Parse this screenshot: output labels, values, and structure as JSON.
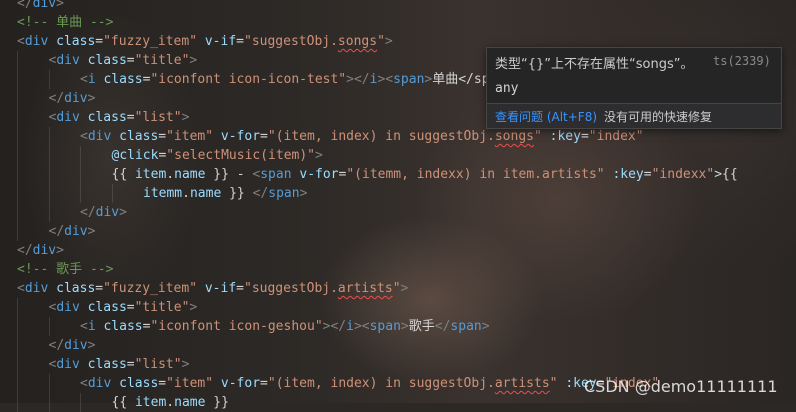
{
  "editor": {
    "lines": [
      [
        {
          "t": "</",
          "c": "punc"
        },
        {
          "t": "div",
          "c": "tag"
        },
        {
          "t": ">",
          "c": "punc"
        }
      ],
      [
        {
          "t": "<!-- 单曲 -->",
          "c": "comment"
        }
      ],
      [
        {
          "t": "<",
          "c": "punc"
        },
        {
          "t": "div",
          "c": "tag"
        },
        {
          "t": " "
        },
        {
          "t": "class",
          "c": "attr"
        },
        {
          "t": "=",
          "c": "text"
        },
        {
          "t": "\"fuzzy_item\"",
          "c": "str"
        },
        {
          "t": " "
        },
        {
          "t": "v-if",
          "c": "attr"
        },
        {
          "t": "=",
          "c": "text"
        },
        {
          "t": "\"suggestObj.",
          "c": "str"
        },
        {
          "t": "songs",
          "c": "str",
          "squiggle": true
        },
        {
          "t": "\"",
          "c": "str"
        },
        {
          "t": ">",
          "c": "punc"
        }
      ],
      [
        {
          "t": "<",
          "c": "punc"
        },
        {
          "t": "div",
          "c": "tag"
        },
        {
          "t": " "
        },
        {
          "t": "class",
          "c": "attr"
        },
        {
          "t": "=",
          "c": "text"
        },
        {
          "t": "\"title\"",
          "c": "str"
        },
        {
          "t": ">",
          "c": "punc"
        }
      ],
      [
        {
          "t": "<",
          "c": "punc"
        },
        {
          "t": "i",
          "c": "tag"
        },
        {
          "t": " "
        },
        {
          "t": "class",
          "c": "attr"
        },
        {
          "t": "=",
          "c": "text"
        },
        {
          "t": "\"iconfont icon-icon-test\"",
          "c": "str"
        },
        {
          "t": "></",
          "c": "punc"
        },
        {
          "t": "i",
          "c": "tag"
        },
        {
          "t": "><",
          "c": "punc"
        },
        {
          "t": "span",
          "c": "tag"
        },
        {
          "t": ">",
          "c": "punc"
        },
        {
          "t": "单曲</spa",
          "c": "text"
        }
      ],
      [
        {
          "t": "</",
          "c": "punc"
        },
        {
          "t": "div",
          "c": "tag"
        },
        {
          "t": ">",
          "c": "punc"
        }
      ],
      [
        {
          "t": "<",
          "c": "punc"
        },
        {
          "t": "div",
          "c": "tag"
        },
        {
          "t": " "
        },
        {
          "t": "class",
          "c": "attr"
        },
        {
          "t": "=",
          "c": "text"
        },
        {
          "t": "\"list\"",
          "c": "str"
        },
        {
          "t": ">",
          "c": "punc"
        }
      ],
      [
        {
          "t": "<",
          "c": "punc"
        },
        {
          "t": "div",
          "c": "tag"
        },
        {
          "t": " "
        },
        {
          "t": "class",
          "c": "attr"
        },
        {
          "t": "=",
          "c": "text"
        },
        {
          "t": "\"item\"",
          "c": "str"
        },
        {
          "t": " "
        },
        {
          "t": "v-for",
          "c": "attr"
        },
        {
          "t": "=",
          "c": "text"
        },
        {
          "t": "\"(item, index) in suggestObj.",
          "c": "str"
        },
        {
          "t": "songs",
          "c": "str",
          "squiggle": true
        },
        {
          "t": "\"",
          "c": "str"
        },
        {
          "t": " "
        },
        {
          "t": ":key",
          "c": "attr"
        },
        {
          "t": "=",
          "c": "text"
        },
        {
          "t": "\"index\"",
          "c": "str"
        }
      ],
      [
        {
          "t": "@click",
          "c": "attr"
        },
        {
          "t": "=",
          "c": "text"
        },
        {
          "t": "\"selectMusic(item)\"",
          "c": "str"
        },
        {
          "t": ">",
          "c": "punc"
        }
      ],
      [
        {
          "t": "{{ ",
          "c": "text"
        },
        {
          "t": "item",
          "c": "expr"
        },
        {
          "t": ".",
          "c": "text"
        },
        {
          "t": "name",
          "c": "expr"
        },
        {
          "t": " }} - ",
          "c": "text"
        },
        {
          "t": "<",
          "c": "punc"
        },
        {
          "t": "span",
          "c": "tag"
        },
        {
          "t": " "
        },
        {
          "t": "v-for",
          "c": "attr"
        },
        {
          "t": "=",
          "c": "text"
        },
        {
          "t": "\"(itemm, indexx) in item.artists\"",
          "c": "str"
        },
        {
          "t": " "
        },
        {
          "t": ":key",
          "c": "attr"
        },
        {
          "t": "=",
          "c": "text"
        },
        {
          "t": "\"indexx\"",
          "c": "str"
        },
        {
          "t": ">{{",
          "c": "text"
        }
      ],
      [
        {
          "t": "itemm",
          "c": "expr"
        },
        {
          "t": ".",
          "c": "text"
        },
        {
          "t": "name",
          "c": "expr"
        },
        {
          "t": " }} ",
          "c": "text"
        },
        {
          "t": "</",
          "c": "punc"
        },
        {
          "t": "span",
          "c": "tag"
        },
        {
          "t": ">",
          "c": "punc"
        }
      ],
      [
        {
          "t": "</",
          "c": "punc"
        },
        {
          "t": "div",
          "c": "tag"
        },
        {
          "t": ">",
          "c": "punc"
        }
      ],
      [
        {
          "t": "</",
          "c": "punc"
        },
        {
          "t": "div",
          "c": "tag"
        },
        {
          "t": ">",
          "c": "punc"
        }
      ],
      [
        {
          "t": "</",
          "c": "punc"
        },
        {
          "t": "div",
          "c": "tag"
        },
        {
          "t": ">",
          "c": "punc"
        }
      ],
      [
        {
          "t": "<!-- 歌手 -->",
          "c": "comment"
        }
      ],
      [
        {
          "t": "<",
          "c": "punc"
        },
        {
          "t": "div",
          "c": "tag"
        },
        {
          "t": " "
        },
        {
          "t": "class",
          "c": "attr"
        },
        {
          "t": "=",
          "c": "text"
        },
        {
          "t": "\"fuzzy_item\"",
          "c": "str"
        },
        {
          "t": " "
        },
        {
          "t": "v-if",
          "c": "attr"
        },
        {
          "t": "=",
          "c": "text"
        },
        {
          "t": "\"suggestObj.",
          "c": "str"
        },
        {
          "t": "artists",
          "c": "str",
          "squiggle": true
        },
        {
          "t": "\"",
          "c": "str"
        },
        {
          "t": ">",
          "c": "punc"
        }
      ],
      [
        {
          "t": "<",
          "c": "punc"
        },
        {
          "t": "div",
          "c": "tag"
        },
        {
          "t": " "
        },
        {
          "t": "class",
          "c": "attr"
        },
        {
          "t": "=",
          "c": "text"
        },
        {
          "t": "\"title\"",
          "c": "str"
        },
        {
          "t": ">",
          "c": "punc"
        }
      ],
      [
        {
          "t": "<",
          "c": "punc"
        },
        {
          "t": "i",
          "c": "tag"
        },
        {
          "t": " "
        },
        {
          "t": "class",
          "c": "attr"
        },
        {
          "t": "=",
          "c": "text"
        },
        {
          "t": "\"iconfont icon-geshou\"",
          "c": "str"
        },
        {
          "t": "></",
          "c": "punc"
        },
        {
          "t": "i",
          "c": "tag"
        },
        {
          "t": "><",
          "c": "punc"
        },
        {
          "t": "span",
          "c": "tag"
        },
        {
          "t": ">",
          "c": "punc"
        },
        {
          "t": "歌手",
          "c": "text"
        },
        {
          "t": "</",
          "c": "punc"
        },
        {
          "t": "span",
          "c": "tag"
        },
        {
          "t": ">",
          "c": "punc"
        }
      ],
      [
        {
          "t": "</",
          "c": "punc"
        },
        {
          "t": "div",
          "c": "tag"
        },
        {
          "t": ">",
          "c": "punc"
        }
      ],
      [
        {
          "t": "<",
          "c": "punc"
        },
        {
          "t": "div",
          "c": "tag"
        },
        {
          "t": " "
        },
        {
          "t": "class",
          "c": "attr"
        },
        {
          "t": "=",
          "c": "text"
        },
        {
          "t": "\"list\"",
          "c": "str"
        },
        {
          "t": ">",
          "c": "punc"
        }
      ],
      [
        {
          "t": "<",
          "c": "punc"
        },
        {
          "t": "div",
          "c": "tag"
        },
        {
          "t": " "
        },
        {
          "t": "class",
          "c": "attr"
        },
        {
          "t": "=",
          "c": "text"
        },
        {
          "t": "\"item\"",
          "c": "str"
        },
        {
          "t": " "
        },
        {
          "t": "v-for",
          "c": "attr"
        },
        {
          "t": "=",
          "c": "text"
        },
        {
          "t": "\"(item, index) in suggestObj.",
          "c": "str"
        },
        {
          "t": "artists",
          "c": "str",
          "squiggle": true
        },
        {
          "t": "\"",
          "c": "str"
        },
        {
          "t": " "
        },
        {
          "t": ":key",
          "c": "attr"
        },
        {
          "t": "=",
          "c": "text"
        },
        {
          "t": "\"index\"",
          "c": "str"
        }
      ],
      [
        {
          "t": "{{ ",
          "c": "text"
        },
        {
          "t": "item",
          "c": "expr"
        },
        {
          "t": ".",
          "c": "text"
        },
        {
          "t": "name",
          "c": "expr"
        },
        {
          "t": " }}",
          "c": "text"
        }
      ]
    ],
    "indents": [
      0,
      0,
      0,
      1,
      2,
      1,
      1,
      2,
      3,
      3,
      4,
      2,
      1,
      0,
      0,
      0,
      1,
      2,
      1,
      1,
      2,
      3
    ]
  },
  "hover": {
    "message": "类型“{}”上不存在属性“songs”。",
    "code": "ts(2339)",
    "type_text": "any",
    "view_problem": "查看问题 (Alt+F8)",
    "no_fix": "没有可用的快速修复"
  },
  "watermark": "CSDN @demo11111111"
}
